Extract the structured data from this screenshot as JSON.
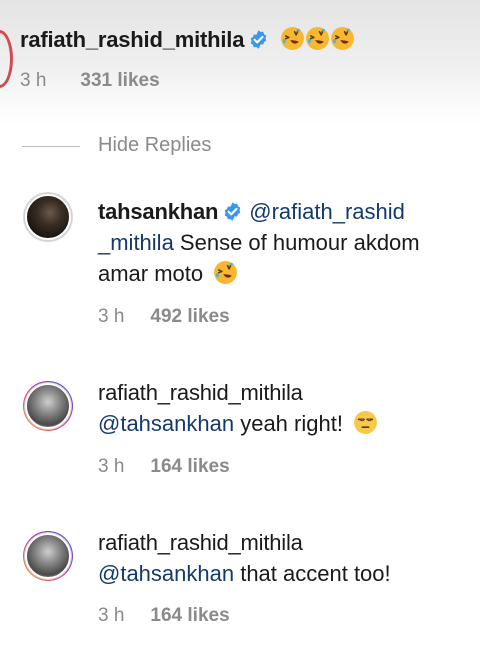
{
  "top_comment": {
    "username": "rafiath_rashid_mithila",
    "emojis": [
      "rofl-emoji",
      "rofl-emoji",
      "rofl-emoji"
    ],
    "time": "3 h",
    "likes": "331 likes"
  },
  "hide_replies": "Hide Replies",
  "replies": [
    {
      "username": "tahsankhan",
      "verified": true,
      "mention_part1": "@rafiath_rashid",
      "mention_part2": "_mithila",
      "text_after_mention": " Sense of humour akdom",
      "text_line3": "amar moto",
      "emoji": "rofl-emoji",
      "time": "3 h",
      "likes": "492 likes"
    },
    {
      "username": "rafiath_rashid_mithila",
      "mention": "@tahsankhan",
      "text": " yeah right!",
      "emoji": "unamused-emoji",
      "time": "3 h",
      "likes": "164 likes"
    },
    {
      "username": "rafiath_rashid_mithila",
      "mention": "@tahsankhan",
      "text": " that accent too!",
      "time": "3 h",
      "likes": "164 likes"
    }
  ],
  "colors": {
    "verified_blue": "#3897f0",
    "mention_blue": "#143a6b",
    "meta_gray": "#8a8a8a",
    "emoji_yellow": "#f7b731"
  }
}
